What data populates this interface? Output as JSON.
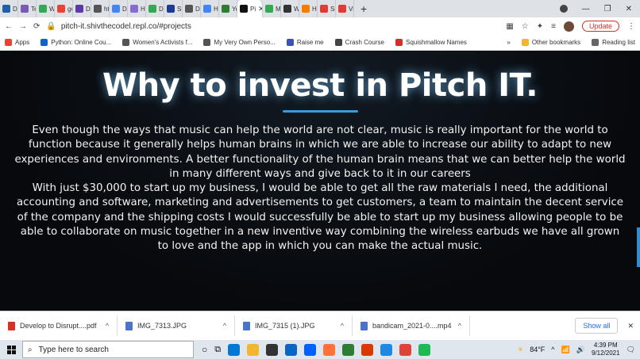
{
  "browser": {
    "tabs": [
      {
        "label": "D",
        "color": "#1f5fa8"
      },
      {
        "label": "Te",
        "color": "#7a5ab5"
      },
      {
        "label": "W",
        "color": "#34a853"
      },
      {
        "label": "ge",
        "color": "#ea4335"
      },
      {
        "label": "D",
        "color": "#5c3aa8"
      },
      {
        "label": "ht",
        "color": "#555555"
      },
      {
        "label": "D",
        "color": "#4285f4"
      },
      {
        "label": "H",
        "color": "#8a6bd1"
      },
      {
        "label": "D",
        "color": "#34a853"
      },
      {
        "label": "Sl",
        "color": "#1d3c8f"
      },
      {
        "label": "D",
        "color": "#555555"
      },
      {
        "label": "H",
        "color": "#4285f4"
      },
      {
        "label": "Yo",
        "color": "#2e7d32"
      },
      {
        "label": "Pi",
        "color": "#111111"
      },
      {
        "label": "M",
        "color": "#34a853"
      },
      {
        "label": "W",
        "color": "#333333"
      },
      {
        "label": "H",
        "color": "#f57c00"
      },
      {
        "label": "Sc",
        "color": "#e53935"
      },
      {
        "label": "Vi",
        "color": "#e53935"
      }
    ],
    "active_tab_close": "✕",
    "new_tab": "+",
    "url": "pitch-it.shivthecodel.repl.co/#projects",
    "update_label": "Update",
    "back": "←",
    "forward": "→",
    "reload": "⟳"
  },
  "bookmarks": {
    "items": [
      {
        "label": "Apps",
        "color": "#ea4335"
      },
      {
        "label": "Python: Online Cou...",
        "color": "#1565c0"
      },
      {
        "label": "Women's Activists f...",
        "color": "#555555"
      },
      {
        "label": "My Very Own Perso...",
        "color": "#555555"
      },
      {
        "label": "Raise me",
        "color": "#3f51b5"
      },
      {
        "label": "Crash Course",
        "color": "#444444"
      },
      {
        "label": "Squishmallow Names",
        "color": "#d32f2f"
      }
    ],
    "overflow": "»",
    "other": "Other bookmarks",
    "reading_list": "Reading list"
  },
  "page": {
    "heading": "Why to invest in Pitch IT.",
    "paragraph1": "Even though the ways that music can help the world are not clear, music is really important for the world to function because it generally helps human brains in which we are able to increase our ability to adapt to new experiences and environments. A better functionality of the human brain means that we can better help the world in many different ways and give back to it in our careers",
    "paragraph2": "With just $30,000 to start up my business, I would be able to get all the raw materials I need, the additional accounting and software, marketing and advertisements to get customers, a team to maintain the decent service of the company and the shipping costs I would successfully be able to start up my business allowing people to be able to collaborate on music together in a new inventive way combining the wireless earbuds we have all grown to love and the app in which you can make the actual music."
  },
  "downloads": {
    "items": [
      {
        "label": "Develop to Disrupt....pdf",
        "type": "pdf"
      },
      {
        "label": "IMG_7313.JPG",
        "type": "img"
      },
      {
        "label": "IMG_7315 (1).JPG",
        "type": "img"
      },
      {
        "label": "bandicam_2021-0....mp4",
        "type": "video"
      }
    ],
    "show_all": "Show all",
    "close": "✕"
  },
  "taskbar": {
    "search_placeholder": "Type here to search",
    "temperature": "84°F",
    "time": "4:39 PM",
    "date": "9/12/2021",
    "apps": [
      "#0078d4",
      "#f2b632",
      "#333333",
      "#0a66c2",
      "#0061fe",
      "#ff7139",
      "#2e7d32",
      "#d83b01",
      "#1e88e5",
      "#db4437",
      "#1db954"
    ]
  }
}
